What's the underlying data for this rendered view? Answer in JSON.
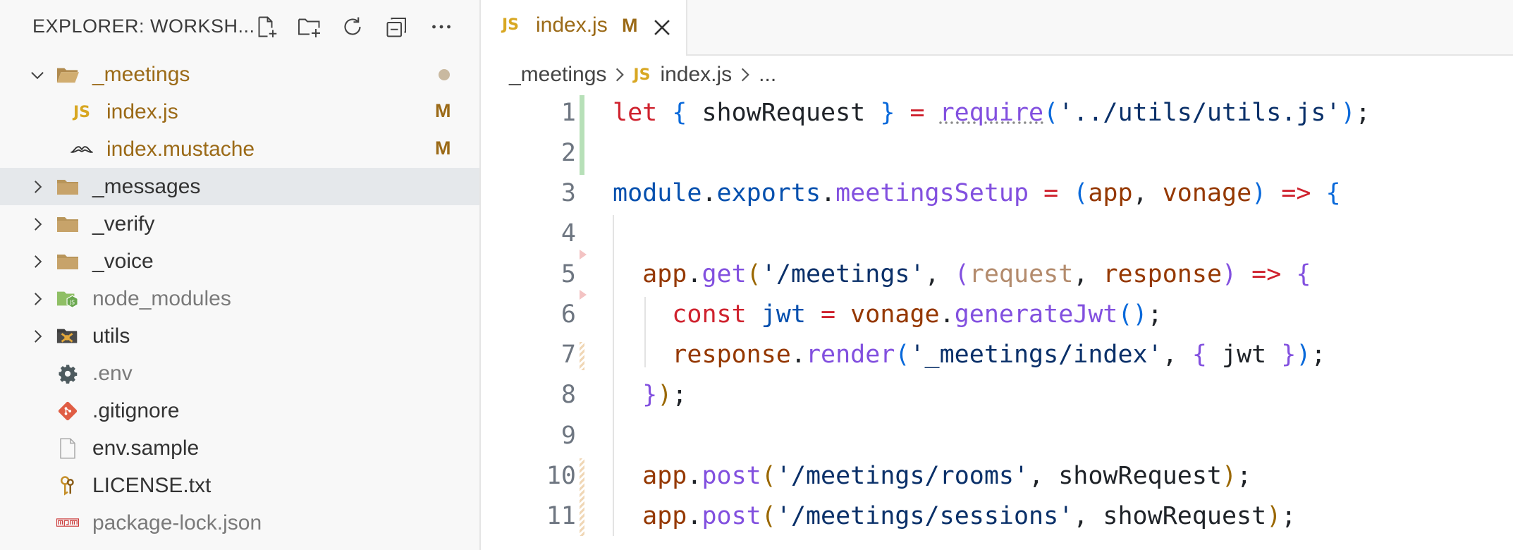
{
  "explorer": {
    "title": "EXPLORER: WORKSH...",
    "actions": [
      {
        "name": "new-file-button",
        "icon": "new-file-icon"
      },
      {
        "name": "new-folder-button",
        "icon": "new-folder-icon"
      },
      {
        "name": "refresh-button",
        "icon": "refresh-icon"
      },
      {
        "name": "collapse-all-button",
        "icon": "collapse-all-icon"
      },
      {
        "name": "more-actions-button",
        "icon": "ellipsis-icon"
      }
    ],
    "tree": [
      {
        "label": "_meetings",
        "type": "folder-open",
        "expanded": true,
        "modified": true,
        "badge": ""
      },
      {
        "label": "index.js",
        "type": "js",
        "modified": true,
        "badge": "M"
      },
      {
        "label": "index.mustache",
        "type": "mustache",
        "modified": true,
        "badge": "M"
      },
      {
        "label": "_messages",
        "type": "folder",
        "selected": true
      },
      {
        "label": "_verify",
        "type": "folder"
      },
      {
        "label": "_voice",
        "type": "folder"
      },
      {
        "label": "node_modules",
        "type": "node-folder"
      },
      {
        "label": "utils",
        "type": "utils-folder"
      },
      {
        "label": ".env",
        "type": "gear"
      },
      {
        "label": ".gitignore",
        "type": "git"
      },
      {
        "label": "env.sample",
        "type": "file"
      },
      {
        "label": "LICENSE.txt",
        "type": "license"
      },
      {
        "label": "package-lock.json",
        "type": "npm"
      }
    ],
    "colors": {
      "modified": "#9b6a17",
      "js": "#d8a722",
      "folder": "#c09553"
    }
  },
  "editor": {
    "tab": {
      "label": "index.js",
      "badge": "M",
      "icon": "js-icon",
      "close_icon": "close-icon"
    },
    "breadcrumb": [
      "_meetings",
      "index.js",
      "..."
    ],
    "lines": [
      1,
      2,
      3,
      4,
      5,
      6,
      7,
      8,
      9,
      10,
      11
    ],
    "code": {
      "l1_let": "let",
      "l1_ob": "{",
      "l1_name": " showRequest ",
      "l1_cb": "}",
      "l1_eq": " = ",
      "l1_require": "require",
      "l1_op": "(",
      "l1_str": "'../utils/utils.js'",
      "l1_cp": ")",
      "l1_semi": ";",
      "l3_module": "module",
      "l3_dot1": ".",
      "l3_exports": "exports",
      "l3_dot2": ".",
      "l3_setup": "meetingsSetup",
      "l3_eq": " = ",
      "l3_op": "(",
      "l3_app": "app",
      "l3_comma": ", ",
      "l3_vonage": "vonage",
      "l3_cp": ")",
      "l3_arrow": " => ",
      "l3_ob": "{",
      "l5_app": "app",
      "l5_dot": ".",
      "l5_get": "get",
      "l5_op": "(",
      "l5_str": "'/meetings'",
      "l5_comma": ", ",
      "l5_op2": "(",
      "l5_req": "request",
      "l5_comma2": ", ",
      "l5_res": "response",
      "l5_cp2": ")",
      "l5_arrow": " => ",
      "l5_ob": "{",
      "l6_const": "const",
      "l6_jwt": " jwt",
      "l6_eq": " = ",
      "l6_vonage": "vonage",
      "l6_dot": ".",
      "l6_fn": "generateJwt",
      "l6_parens": "()",
      "l6_semi": ";",
      "l7_response": "response",
      "l7_dot": ".",
      "l7_render": "render",
      "l7_op": "(",
      "l7_str": "'_meetings/index'",
      "l7_comma": ", ",
      "l7_ob": "{",
      "l7_jwt": " jwt ",
      "l7_cb": "}",
      "l7_cp": ")",
      "l7_semi": ";",
      "l8_cb": "}",
      "l8_cp": ")",
      "l8_semi": ";",
      "l10_app": "app",
      "l10_dot": ".",
      "l10_post": "post",
      "l10_op": "(",
      "l10_str": "'/meetings/rooms'",
      "l10_rest": ", showRequest",
      "l10_cp": ")",
      "l10_semi": ";",
      "l11_app": "app",
      "l11_dot": ".",
      "l11_post": "post",
      "l11_op": "(",
      "l11_str": "'/meetings/sessions'",
      "l11_rest": ", showRequest",
      "l11_cp": ")",
      "l11_semi": ";"
    }
  }
}
